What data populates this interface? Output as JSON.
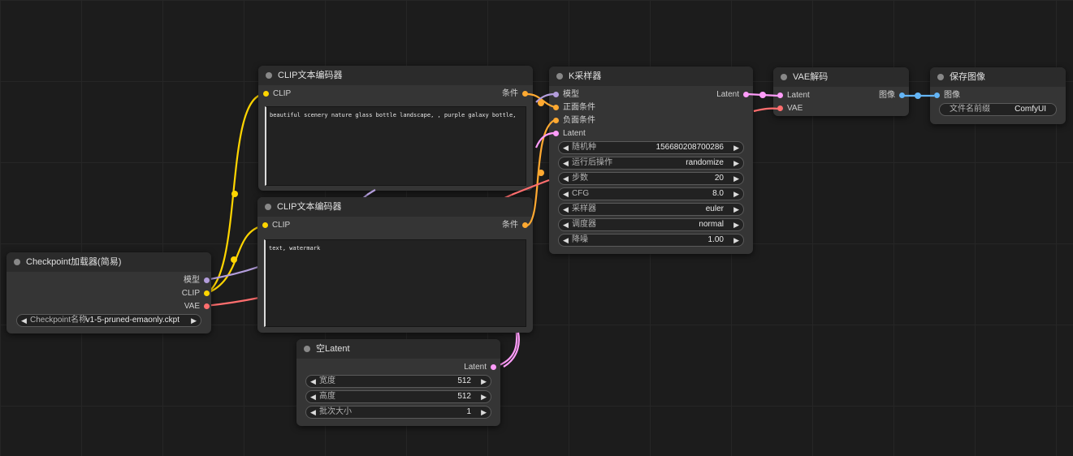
{
  "nodes": {
    "checkpoint": {
      "title": "Checkpoint加载器(简易)",
      "outputs": [
        "模型",
        "CLIP",
        "VAE"
      ],
      "widget_label": "Checkpoint名称",
      "widget_value": "v1-5-pruned-emaonly.ckpt"
    },
    "clip_pos": {
      "title": "CLIP文本编码器",
      "input": "CLIP",
      "output": "条件",
      "text": "beautiful scenery nature glass bottle landscape, , purple galaxy bottle,"
    },
    "clip_neg": {
      "title": "CLIP文本编码器",
      "input": "CLIP",
      "output": "条件",
      "text": "text, watermark"
    },
    "ksampler": {
      "title": "K采样器",
      "inputs": [
        "模型",
        "正面条件",
        "负面条件",
        "Latent"
      ],
      "output": "Latent",
      "widgets": [
        {
          "label": "随机种",
          "value": "156680208700286"
        },
        {
          "label": "运行后操作",
          "value": "randomize"
        },
        {
          "label": "步数",
          "value": "20"
        },
        {
          "label": "CFG",
          "value": "8.0"
        },
        {
          "label": "采样器",
          "value": "euler"
        },
        {
          "label": "调度器",
          "value": "normal"
        },
        {
          "label": "降噪",
          "value": "1.00"
        }
      ]
    },
    "empty_latent": {
      "title": "空Latent",
      "output": "Latent",
      "widgets": [
        {
          "label": "宽度",
          "value": "512"
        },
        {
          "label": "高度",
          "value": "512"
        },
        {
          "label": "批次大小",
          "value": "1"
        }
      ]
    },
    "vae_decode": {
      "title": "VAE解码",
      "inputs": [
        "Latent",
        "VAE"
      ],
      "output": "图像"
    },
    "save_image": {
      "title": "保存图像",
      "input": "图像",
      "widget_label": "文件名前缀",
      "widget_value": "ComfyUI"
    }
  },
  "slot_colors": {
    "model": "#b39ddb",
    "clip": "#ffd500",
    "vae": "#ff6e6e",
    "conditioning": "#ffa931",
    "latent": "#ff9cf9",
    "image": "#64b5f6"
  }
}
